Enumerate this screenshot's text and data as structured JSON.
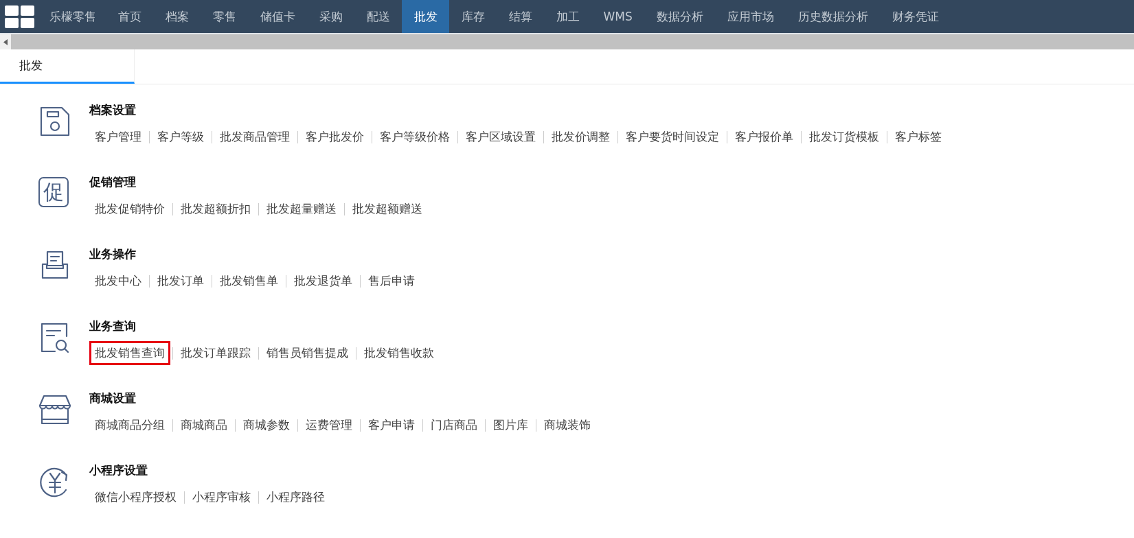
{
  "top_nav": {
    "items": [
      {
        "label": "乐檬零售",
        "selected": false
      },
      {
        "label": "首页",
        "selected": false
      },
      {
        "label": "档案",
        "selected": false
      },
      {
        "label": "零售",
        "selected": false
      },
      {
        "label": "储值卡",
        "selected": false
      },
      {
        "label": "采购",
        "selected": false
      },
      {
        "label": "配送",
        "selected": false
      },
      {
        "label": "批发",
        "selected": true
      },
      {
        "label": "库存",
        "selected": false
      },
      {
        "label": "结算",
        "selected": false
      },
      {
        "label": "加工",
        "selected": false
      },
      {
        "label": "WMS",
        "selected": false
      },
      {
        "label": "数据分析",
        "selected": false
      },
      {
        "label": "应用市场",
        "selected": false
      },
      {
        "label": "历史数据分析",
        "selected": false
      },
      {
        "label": "财务凭证",
        "selected": false
      }
    ]
  },
  "tabs": [
    {
      "label": "批发",
      "selected": true
    }
  ],
  "sections": [
    {
      "kind": "archive",
      "title": "档案设置",
      "links": [
        {
          "label": "客户管理",
          "highlighted": false
        },
        {
          "label": "客户等级",
          "highlighted": false
        },
        {
          "label": "批发商品管理",
          "highlighted": false
        },
        {
          "label": "客户批发价",
          "highlighted": false
        },
        {
          "label": "客户等级价格",
          "highlighted": false
        },
        {
          "label": "客户区域设置",
          "highlighted": false
        },
        {
          "label": "批发价调整",
          "highlighted": false
        },
        {
          "label": "客户要货时间设定",
          "highlighted": false
        },
        {
          "label": "客户报价单",
          "highlighted": false
        },
        {
          "label": "批发订货模板",
          "highlighted": false
        },
        {
          "label": "客户标签",
          "highlighted": false
        }
      ]
    },
    {
      "kind": "glyph",
      "icon_char": "促",
      "title": "促销管理",
      "links": [
        {
          "label": "批发促销特价",
          "highlighted": false
        },
        {
          "label": "批发超额折扣",
          "highlighted": false
        },
        {
          "label": "批发超量赠送",
          "highlighted": false
        },
        {
          "label": "批发超额赠送",
          "highlighted": false
        }
      ]
    },
    {
      "kind": "tray",
      "title": "业务操作",
      "links": [
        {
          "label": "批发中心",
          "highlighted": false
        },
        {
          "label": "批发订单",
          "highlighted": false
        },
        {
          "label": "批发销售单",
          "highlighted": false
        },
        {
          "label": "批发退货单",
          "highlighted": false
        },
        {
          "label": "售后申请",
          "highlighted": false
        }
      ]
    },
    {
      "kind": "query",
      "title": "业务查询",
      "links": [
        {
          "label": "批发销售查询",
          "highlighted": true
        },
        {
          "label": "批发订单跟踪",
          "highlighted": false
        },
        {
          "label": "销售员销售提成",
          "highlighted": false
        },
        {
          "label": "批发销售收款",
          "highlighted": false
        }
      ]
    },
    {
      "kind": "store",
      "title": "商城设置",
      "links": [
        {
          "label": "商城商品分组",
          "highlighted": false
        },
        {
          "label": "商城商品",
          "highlighted": false
        },
        {
          "label": "商城参数",
          "highlighted": false
        },
        {
          "label": "运费管理",
          "highlighted": false
        },
        {
          "label": "客户申请",
          "highlighted": false
        },
        {
          "label": "门店商品",
          "highlighted": false
        },
        {
          "label": "图片库",
          "highlighted": false
        },
        {
          "label": "商城装饰",
          "highlighted": false
        }
      ]
    },
    {
      "kind": "yuan",
      "title": "小程序设置",
      "links": [
        {
          "label": "微信小程序授权",
          "highlighted": false
        },
        {
          "label": "小程序审核",
          "highlighted": false
        },
        {
          "label": "小程序路径",
          "highlighted": false
        }
      ]
    }
  ]
}
